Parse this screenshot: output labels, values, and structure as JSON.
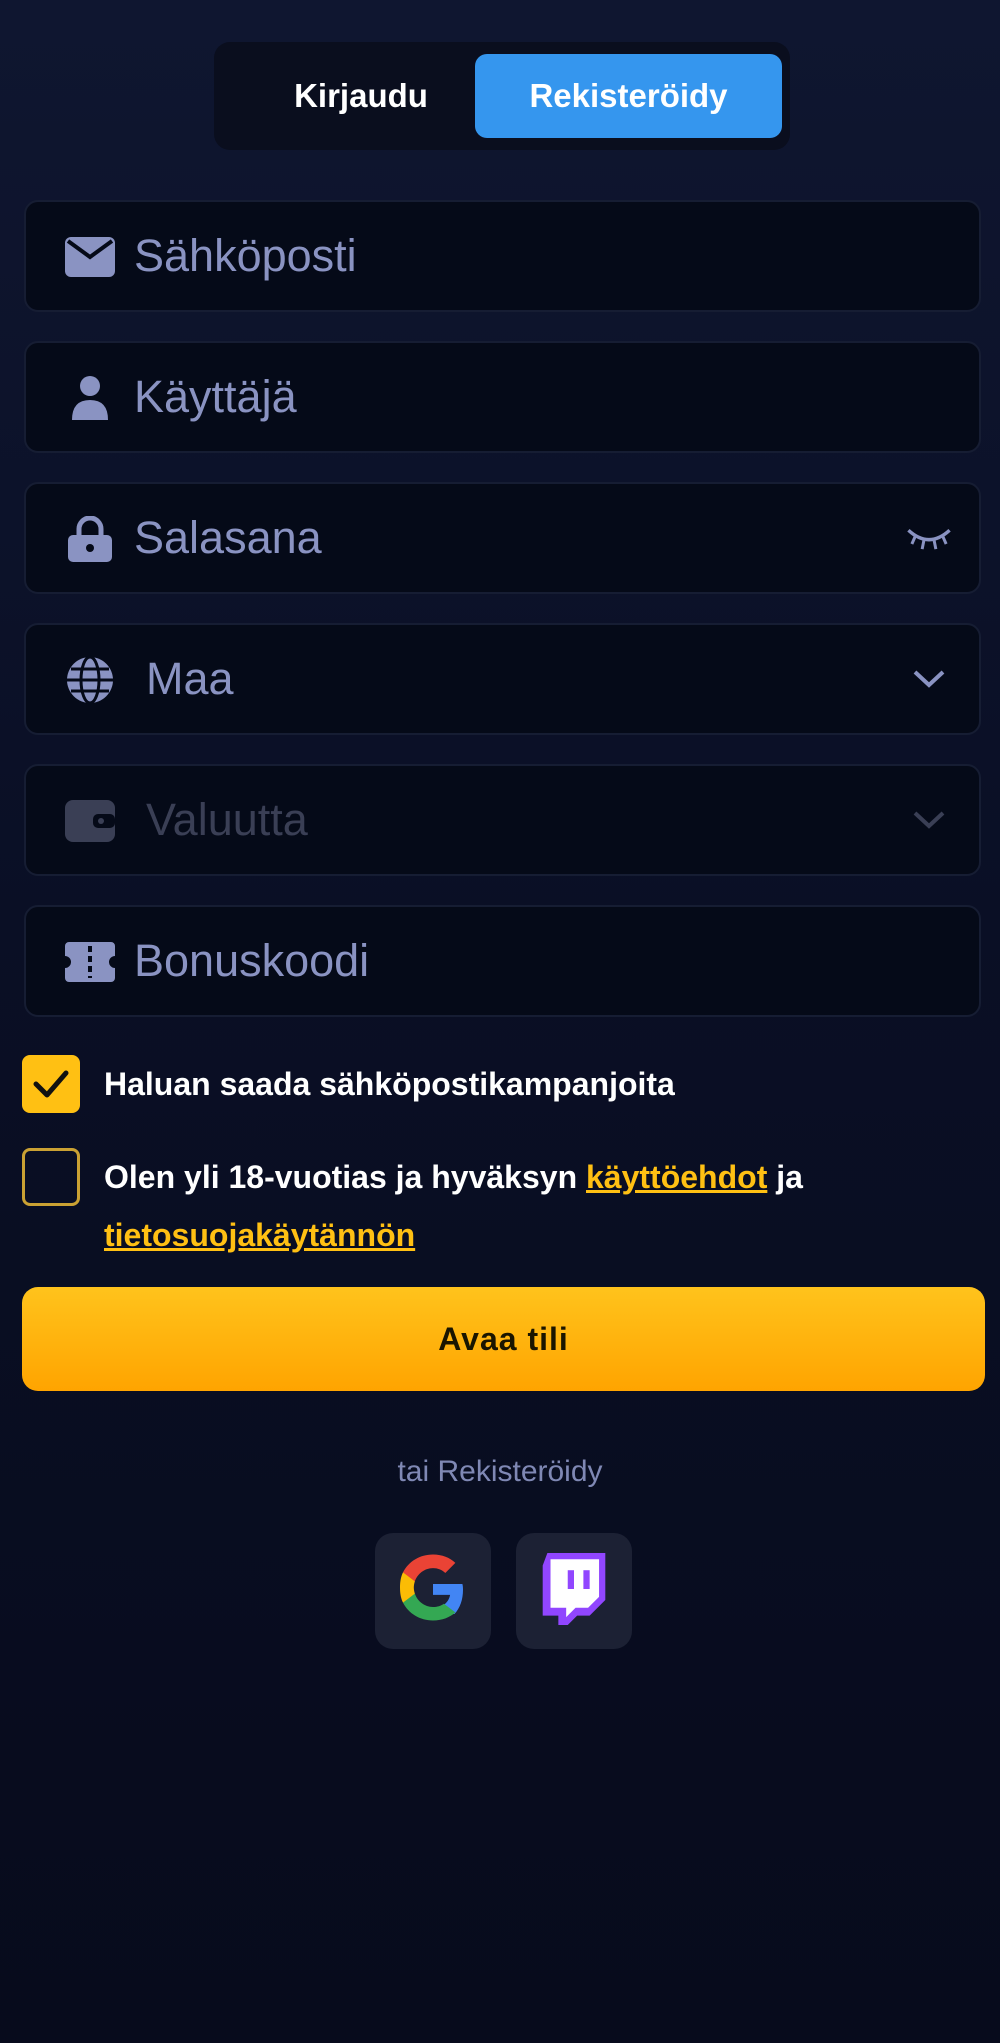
{
  "tabs": {
    "login": "Kirjaudu",
    "register": "Rekisteröidy"
  },
  "fields": {
    "email": {
      "placeholder": "Sähköposti",
      "icon": "mail-icon"
    },
    "user": {
      "placeholder": "Käyttäjä",
      "icon": "user-icon"
    },
    "password": {
      "placeholder": "Salasana",
      "icon": "lock-icon",
      "right_icon": "eye-closed-icon"
    },
    "country": {
      "placeholder": "Maa",
      "icon": "globe-icon",
      "right_icon": "chevron-down-icon"
    },
    "currency": {
      "placeholder": "Valuutta",
      "icon": "wallet-icon",
      "right_icon": "chevron-down-icon",
      "disabled": true
    },
    "bonus": {
      "placeholder": "Bonuskoodi",
      "icon": "ticket-icon"
    }
  },
  "checkboxes": {
    "promo": {
      "label": "Haluan saada sähköpostikampanjoita",
      "checked": true
    },
    "terms": {
      "label_start": "Olen yli 18-vuotias ja hyväksyn",
      "terms_link": "käyttöehdot",
      "label_mid": "ja",
      "privacy_link": "tietosuojakäytännön",
      "checked": false
    }
  },
  "cta": {
    "label": "Avaa tili"
  },
  "alt": {
    "text": "tai Rekisteröidy"
  },
  "social": {
    "google": "google-icon",
    "twitch": "twitch-icon"
  },
  "colors": {
    "accent_blue": "#3596ee",
    "accent_yellow": "#ffc013",
    "background": "#0a0f25"
  }
}
